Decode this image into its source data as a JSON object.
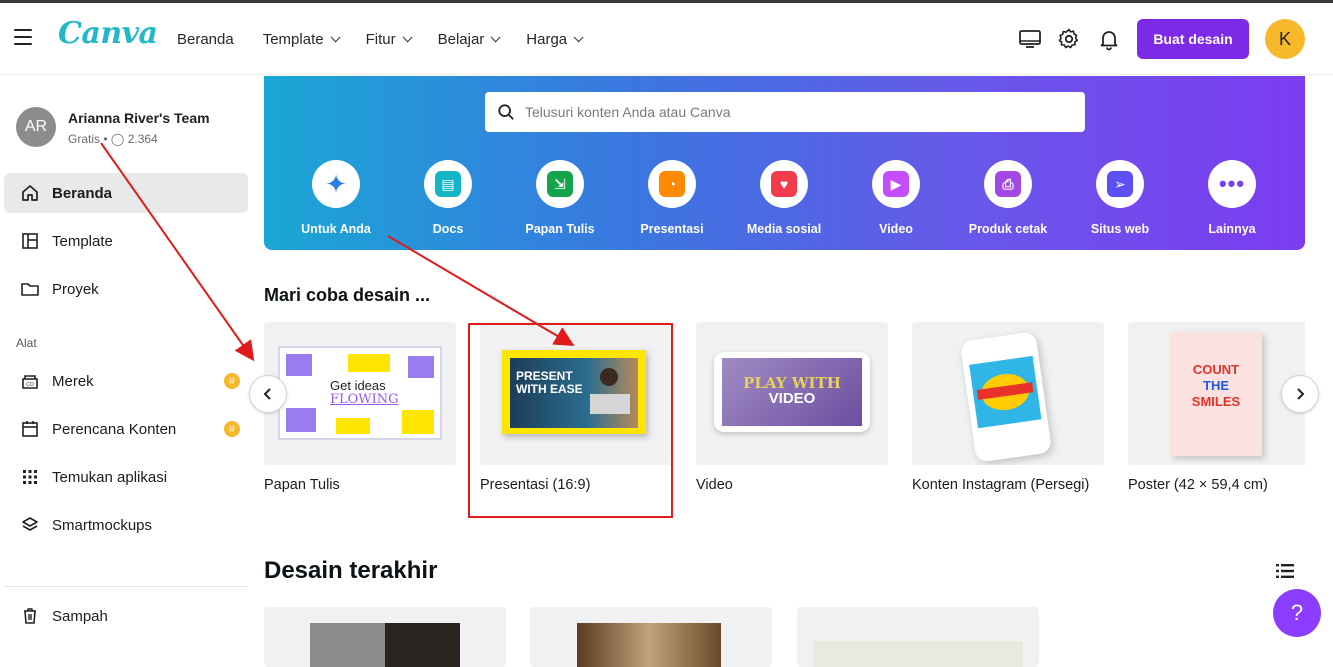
{
  "header": {
    "logo": "Canva",
    "nav": [
      {
        "label": "Beranda",
        "has_dropdown": false
      },
      {
        "label": "Template",
        "has_dropdown": true
      },
      {
        "label": "Fitur",
        "has_dropdown": true
      },
      {
        "label": "Belajar",
        "has_dropdown": true
      },
      {
        "label": "Harga",
        "has_dropdown": true
      }
    ],
    "create_label": "Buat desain",
    "avatar_initial": "K",
    "icons": [
      "monitor-icon",
      "gear-icon",
      "bell-icon"
    ]
  },
  "sidebar": {
    "team_initials": "AR",
    "team_name": "Arianna River's Team",
    "team_plan": "Gratis",
    "team_members": "2.364",
    "items": [
      {
        "label": "Beranda",
        "icon": "home-icon",
        "active": true
      },
      {
        "label": "Template",
        "icon": "template-icon"
      },
      {
        "label": "Proyek",
        "icon": "folder-icon"
      }
    ],
    "tools_heading": "Alat",
    "tools": [
      {
        "label": "Merek",
        "icon": "brand-icon",
        "premium": true
      },
      {
        "label": "Perencana Konten",
        "icon": "calendar-icon",
        "premium": true
      },
      {
        "label": "Temukan aplikasi",
        "icon": "apps-grid-icon"
      },
      {
        "label": "Smartmockups",
        "icon": "layers-icon"
      }
    ],
    "trash": "Sampah"
  },
  "hero": {
    "search_placeholder": "Telusuri konten Anda atau Canva",
    "categories": [
      {
        "label": "Untuk Anda",
        "color": "#2c7be5"
      },
      {
        "label": "Docs",
        "color": "#13b5c5"
      },
      {
        "label": "Papan Tulis",
        "color": "#14a44d"
      },
      {
        "label": "Presentasi",
        "color": "#ff8a00"
      },
      {
        "label": "Media sosial",
        "color": "#f23b4c"
      },
      {
        "label": "Video",
        "color": "#c44dff"
      },
      {
        "label": "Produk cetak",
        "color": "#a347e6"
      },
      {
        "label": "Situs web",
        "color": "#5b4ff5"
      },
      {
        "label": "Lainnya",
        "color": "#7c3cf0"
      }
    ]
  },
  "try_section": {
    "title": "Mari coba desain ...",
    "cards": [
      {
        "label": "Papan Tulis",
        "thumb_text": [
          "Get ideas",
          "FLOWING"
        ]
      },
      {
        "label": "Presentasi (16:9)",
        "thumb_text": [
          "PRESENT",
          "WITH EASE"
        ]
      },
      {
        "label": "Video",
        "thumb_text": [
          "PLAY WITH",
          "VIDEO"
        ]
      },
      {
        "label": "Konten Instagram (Persegi)",
        "thumb_text": []
      },
      {
        "label": "Poster (42 × 59,4 cm)",
        "thumb_text": [
          "COUNT",
          "THE",
          "SMILES"
        ]
      }
    ]
  },
  "recent_section": {
    "title": "Desain terakhir"
  },
  "help_label": "?",
  "colors": {
    "brand_purple": "#7d2ae8",
    "logo_teal": "#23b7c9",
    "annotation_red": "#e01b1b"
  }
}
